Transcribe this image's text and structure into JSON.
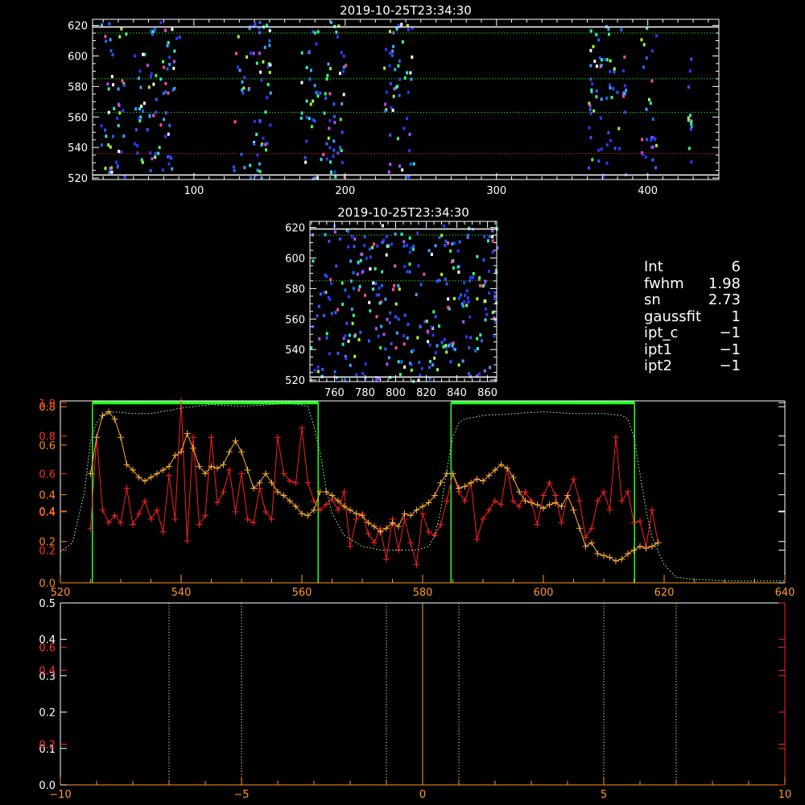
{
  "info_panel": {
    "rows": [
      {
        "key": "Int",
        "value": "6"
      },
      {
        "key": "fwhm",
        "value": "1.98"
      },
      {
        "key": "sn",
        "value": "2.73"
      },
      {
        "key": "gaussfit",
        "value": "1"
      },
      {
        "key": "ipt_c",
        "value": "−1"
      },
      {
        "key": "ipt1",
        "value": "−1"
      },
      {
        "key": "ipt2",
        "value": "−1"
      }
    ]
  },
  "chart_data": [
    {
      "type": "heatmap",
      "title": "2019-10-25T23:34:30",
      "xlim": [
        33,
        447
      ],
      "ylim": [
        519,
        624
      ],
      "xticks": [
        100,
        200,
        300,
        400
      ],
      "yticks": [
        520,
        540,
        560,
        580,
        600,
        620
      ],
      "x_minor_step": 10,
      "y_minor_step": 5,
      "palette": [
        "#2a3bff",
        "#3355ff",
        "#1e6bff",
        "#3aa6ff",
        "#2ee8d0",
        "#38ff7a",
        "#9cff3a",
        "#ff4aa0",
        "#b64cff",
        "#ffffff"
      ],
      "data_bands": [
        [
          38,
          55
        ],
        [
          60,
          90
        ],
        [
          125,
          150
        ],
        [
          170,
          200
        ],
        [
          225,
          245
        ],
        [
          360,
          385
        ],
        [
          395,
          405
        ],
        [
          425,
          430
        ]
      ],
      "hlines": [
        {
          "y": 522,
          "color": "#ffffff",
          "style": "solid"
        },
        {
          "y": 536,
          "color": "#ff3030",
          "style": "dotted"
        },
        {
          "y": 563,
          "color": "#30ff30",
          "style": "dotted"
        },
        {
          "y": 585,
          "color": "#30ff30",
          "style": "dotted"
        },
        {
          "y": 615,
          "color": "#30ff30",
          "style": "dotted"
        },
        {
          "y": 619,
          "color": "#ffffff",
          "style": "solid"
        }
      ]
    },
    {
      "type": "heatmap",
      "title": "2019-10-25T23:34:30",
      "xlim": [
        744,
        866
      ],
      "ylim": [
        519,
        624
      ],
      "xticks": [
        760,
        780,
        800,
        820,
        840,
        860
      ],
      "yticks": [
        520,
        540,
        560,
        580,
        600,
        620
      ],
      "x_minor_step": 5,
      "y_minor_step": 5,
      "palette": [
        "#2a3bff",
        "#3355ff",
        "#1e6bff",
        "#3aa6ff",
        "#2ee8d0",
        "#38ff7a",
        "#9cff3a",
        "#ff4aa0",
        "#b64cff",
        "#ffffff"
      ],
      "data_bands": [
        [
          744,
          866
        ]
      ],
      "hlines": [
        {
          "y": 522,
          "color": "#ffffff",
          "style": "solid"
        },
        {
          "y": 585,
          "color": "#30ff30",
          "style": "dotted"
        },
        {
          "y": 615,
          "color": "#30ff30",
          "style": "dotted"
        },
        {
          "y": 619,
          "color": "#ffffff",
          "style": "solid"
        }
      ]
    },
    {
      "type": "line",
      "xlim": [
        520,
        640
      ],
      "ylim": [
        0,
        1.0
      ],
      "xticks": [
        520,
        540,
        560,
        580,
        600,
        620,
        640
      ],
      "x_minor_step": 5,
      "left_axis_ticks": [
        {
          "label": "0.0",
          "value": 0.0,
          "color": "#ff8c00"
        },
        {
          "label": "0.2",
          "value": 0.18,
          "color": "#ff3030"
        },
        {
          "label": "0.2",
          "value": 0.227,
          "color": "#ff8c00"
        },
        {
          "label": "0.4",
          "value": 0.39,
          "color": "#ff3030"
        },
        {
          "label": "0.4",
          "value": 0.394,
          "color": "#ff8c00"
        },
        {
          "label": "0.4",
          "value": 0.484,
          "color": "#ff8c00"
        },
        {
          "label": "0.6",
          "value": 0.6,
          "color": "#ff3030"
        },
        {
          "label": "0.6",
          "value": 0.757,
          "color": "#ff8c00"
        },
        {
          "label": "0.8",
          "value": 0.807,
          "color": "#ff3030"
        },
        {
          "label": "0.8",
          "value": 0.968,
          "color": "#ff8c00"
        },
        {
          "label": "1.0",
          "value": 0.99,
          "color": "#ff3030"
        }
      ],
      "green_boxes": [
        [
          525.3,
          562.7
        ],
        [
          584.7,
          615.1
        ]
      ],
      "box_top": 0.99,
      "series": [
        {
          "color": "#ff2020",
          "x": [
            525,
            526,
            527,
            528,
            529,
            530,
            531,
            532,
            533,
            534,
            535,
            536,
            537,
            538,
            539,
            540,
            541,
            542,
            543,
            544,
            545,
            546,
            547,
            548,
            549,
            550,
            551,
            552,
            553,
            554,
            555,
            556,
            557,
            558,
            559,
            560,
            561,
            562,
            563,
            564,
            565,
            566,
            567,
            568,
            569,
            570,
            571,
            572,
            573,
            574,
            575,
            576,
            577,
            578,
            579,
            580,
            581,
            582,
            583,
            584,
            585,
            586,
            587,
            588,
            589,
            590,
            591,
            592,
            593,
            594,
            595,
            596,
            597,
            598,
            599,
            600,
            601,
            602,
            603,
            604,
            605,
            606,
            607,
            608,
            609,
            610,
            611,
            612,
            613,
            614,
            615,
            616,
            617,
            618,
            619
          ],
          "y": [
            0.3,
            0.8,
            0.4,
            0.33,
            0.37,
            0.33,
            0.52,
            0.32,
            0.38,
            0.45,
            0.35,
            0.4,
            0.28,
            0.59,
            0.35,
            1.0,
            0.23,
            0.8,
            0.32,
            0.37,
            0.8,
            0.44,
            0.5,
            0.62,
            0.39,
            0.6,
            0.35,
            0.33,
            0.52,
            0.39,
            0.35,
            0.8,
            0.6,
            0.56,
            0.55,
            0.85,
            0.55,
            0.45,
            0.4,
            0.43,
            0.46,
            0.4,
            0.5,
            0.2,
            0.35,
            0.38,
            0.27,
            0.22,
            0.3,
            0.13,
            0.35,
            0.18,
            0.35,
            0.22,
            0.1,
            0.38,
            0.28,
            0.26,
            0.32,
            0.45,
            0.6,
            0.5,
            0.45,
            0.55,
            0.24,
            0.35,
            0.4,
            0.45,
            0.43,
            0.63,
            0.45,
            0.42,
            0.5,
            0.45,
            0.32,
            0.48,
            0.55,
            0.48,
            0.33,
            0.48,
            0.57,
            0.45,
            0.25,
            0.3,
            0.45,
            0.5,
            0.4,
            0.8,
            0.45,
            0.5,
            0.33,
            0.34,
            0.2,
            0.4,
            0.22
          ]
        },
        {
          "color": "#ffb030",
          "x": [
            525,
            526,
            527,
            528,
            529,
            530,
            531,
            532,
            533,
            534,
            535,
            536,
            537,
            538,
            539,
            540,
            541,
            542,
            543,
            544,
            545,
            546,
            547,
            548,
            549,
            550,
            551,
            552,
            553,
            554,
            555,
            556,
            557,
            558,
            559,
            560,
            561,
            562,
            563,
            564,
            565,
            566,
            567,
            568,
            569,
            570,
            571,
            572,
            573,
            574,
            575,
            576,
            577,
            578,
            579,
            580,
            581,
            582,
            583,
            584,
            585,
            586,
            587,
            588,
            589,
            590,
            591,
            592,
            593,
            594,
            595,
            596,
            597,
            598,
            599,
            600,
            601,
            602,
            603,
            604,
            605,
            606,
            607,
            608,
            609,
            610,
            611,
            612,
            613,
            614,
            615,
            616,
            617,
            618,
            619
          ],
          "y": [
            0.6,
            0.8,
            0.92,
            0.94,
            0.9,
            0.8,
            0.65,
            0.62,
            0.58,
            0.56,
            0.58,
            0.6,
            0.62,
            0.64,
            0.7,
            0.72,
            0.82,
            0.74,
            0.64,
            0.6,
            0.64,
            0.63,
            0.65,
            0.72,
            0.78,
            0.72,
            0.62,
            0.52,
            0.55,
            0.6,
            0.55,
            0.5,
            0.48,
            0.45,
            0.42,
            0.38,
            0.37,
            0.4,
            0.5,
            0.5,
            0.48,
            0.45,
            0.42,
            0.4,
            0.38,
            0.37,
            0.33,
            0.31,
            0.28,
            0.3,
            0.33,
            0.31,
            0.38,
            0.37,
            0.4,
            0.42,
            0.44,
            0.48,
            0.55,
            0.6,
            0.6,
            0.52,
            0.53,
            0.55,
            0.57,
            0.56,
            0.59,
            0.62,
            0.65,
            0.63,
            0.58,
            0.5,
            0.45,
            0.44,
            0.43,
            0.41,
            0.43,
            0.44,
            0.42,
            0.48,
            0.4,
            0.3,
            0.2,
            0.22,
            0.16,
            0.15,
            0.14,
            0.12,
            0.13,
            0.16,
            0.18,
            0.2,
            0.19,
            0.2,
            0.22
          ]
        },
        {
          "color": "#b8ffb8",
          "style": "dotted",
          "x": [
            520,
            522,
            524,
            525,
            526,
            527,
            529,
            532,
            535,
            540,
            545,
            550,
            555,
            558,
            561,
            562,
            563,
            564,
            565,
            567,
            570,
            573,
            576,
            579,
            581,
            582,
            583,
            584,
            585,
            586,
            587,
            590,
            595,
            600,
            605,
            610,
            613,
            614,
            615,
            616,
            617,
            618,
            620,
            622,
            625,
            630,
            635,
            640
          ],
          "y": [
            0.17,
            0.22,
            0.5,
            0.78,
            0.88,
            0.92,
            0.94,
            0.93,
            0.93,
            0.96,
            0.98,
            0.97,
            0.98,
            0.99,
            0.97,
            0.86,
            0.72,
            0.52,
            0.38,
            0.26,
            0.2,
            0.18,
            0.18,
            0.18,
            0.2,
            0.26,
            0.4,
            0.62,
            0.8,
            0.88,
            0.9,
            0.92,
            0.93,
            0.94,
            0.93,
            0.93,
            0.92,
            0.9,
            0.8,
            0.6,
            0.4,
            0.25,
            0.1,
            0.03,
            0.02,
            0.01,
            0.01,
            0.01
          ]
        }
      ]
    },
    {
      "type": "line",
      "xlim": [
        -10,
        10
      ],
      "ylim": [
        0,
        0.5
      ],
      "xticks": [
        -10,
        -5,
        0,
        5,
        10
      ],
      "x_minor_step": 1,
      "left_axis_ticks": [
        {
          "label": "0.0",
          "value": 0.0,
          "color": "#ffffff"
        },
        {
          "label": "0.1",
          "value": 0.1,
          "color": "#ffffff"
        },
        {
          "label": "0.2",
          "value": 0.112,
          "color": "#ff3030"
        },
        {
          "label": "0.2",
          "value": 0.2,
          "color": "#ffffff"
        },
        {
          "label": "0.3",
          "value": 0.3,
          "color": "#ffffff"
        },
        {
          "label": "0.4",
          "value": 0.315,
          "color": "#ff3030"
        },
        {
          "label": "0.4",
          "value": 0.4,
          "color": "#ffffff"
        },
        {
          "label": "0.6",
          "value": 0.378,
          "color": "#ff3030"
        },
        {
          "label": "0.5",
          "value": 0.5,
          "color": "#ffffff"
        }
      ],
      "vlines": [
        {
          "x": -7,
          "color": "#ffffa0",
          "style": "dotted"
        },
        {
          "x": -5,
          "color": "#ffffa0",
          "style": "dotted"
        },
        {
          "x": -1,
          "color": "#ffffa0",
          "style": "dotted"
        },
        {
          "x": 0,
          "color": "#ff9a20",
          "style": "solid"
        },
        {
          "x": 1,
          "color": "#ffffa0",
          "style": "dotted"
        },
        {
          "x": 5,
          "color": "#ffffa0",
          "style": "dotted"
        },
        {
          "x": 7,
          "color": "#ffffa0",
          "style": "dotted"
        }
      ]
    }
  ]
}
